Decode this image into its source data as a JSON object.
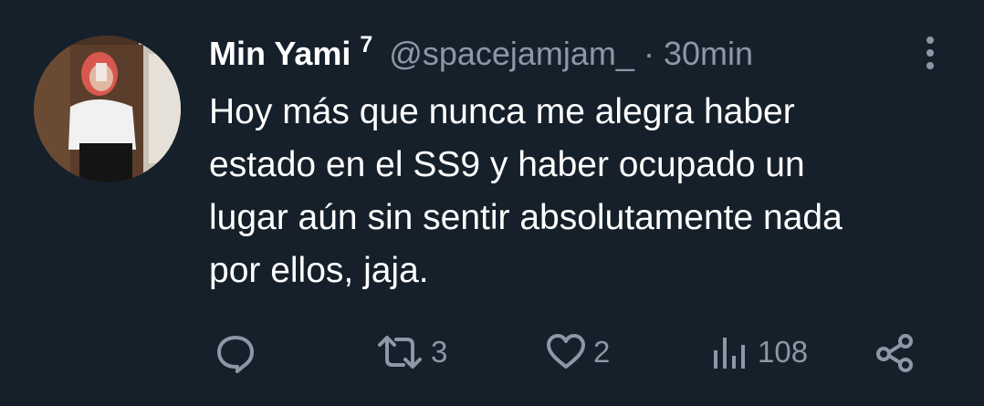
{
  "tweet": {
    "author_name": "Min Yami",
    "author_badge": "7",
    "handle": "@spacejamjam_",
    "separator": "·",
    "time": "30min",
    "lines": [
      "Hoy más que nunca me alegra haber",
      "estado en el SS9 y haber ocupado un",
      "lugar aún sin sentir absolutamente nada",
      "por ellos, jaja."
    ]
  },
  "actions": {
    "reply": {
      "icon": "reply-icon",
      "count": ""
    },
    "retweet": {
      "icon": "retweet-icon",
      "count": "3"
    },
    "like": {
      "icon": "heart-icon",
      "count": "2"
    },
    "views": {
      "icon": "views-icon",
      "count": "108"
    },
    "share": {
      "icon": "share-icon",
      "count": ""
    }
  },
  "colors": {
    "background": "#15202b",
    "primary_text": "#ffffff",
    "secondary_text": "#8b98a5"
  }
}
